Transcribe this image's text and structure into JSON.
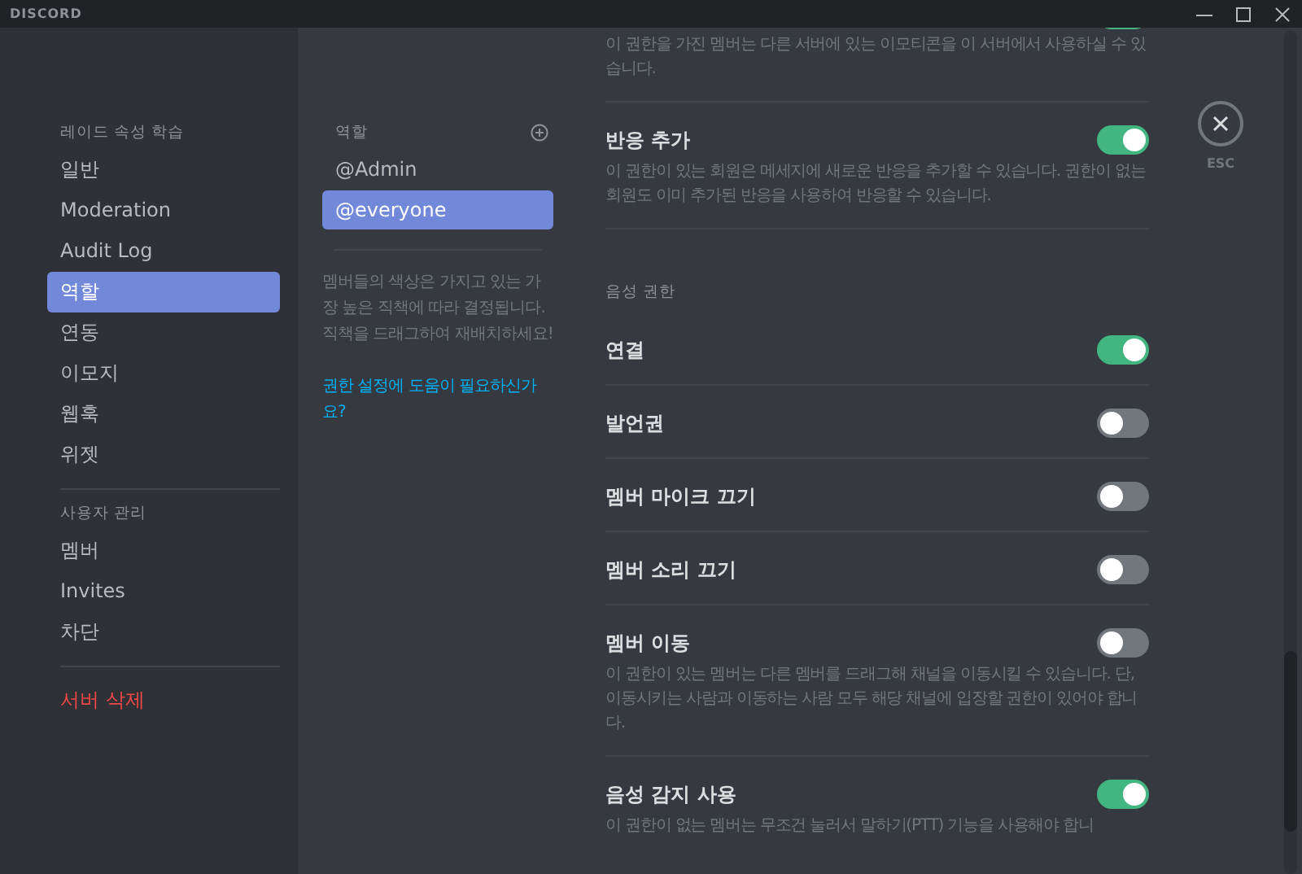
{
  "titlebar": {
    "logo": "DISCORD"
  },
  "sidebar": {
    "sections": [
      {
        "header": "레이드 속성 학습",
        "items": [
          {
            "label": "일반",
            "selected": false
          },
          {
            "label": "Moderation",
            "selected": false
          },
          {
            "label": "Audit Log",
            "selected": false
          },
          {
            "label": "역할",
            "selected": true
          },
          {
            "label": "연동",
            "selected": false
          },
          {
            "label": "이모지",
            "selected": false
          },
          {
            "label": "웹훅",
            "selected": false
          },
          {
            "label": "위젯",
            "selected": false
          }
        ]
      },
      {
        "header": "사용자 관리",
        "items": [
          {
            "label": "멤버",
            "selected": false
          },
          {
            "label": "Invites",
            "selected": false
          },
          {
            "label": "차단",
            "selected": false
          }
        ]
      },
      {
        "items": [
          {
            "label": "서버 삭제",
            "selected": false,
            "kind": "danger"
          }
        ]
      }
    ]
  },
  "roles": {
    "header": "역할",
    "items": [
      {
        "label": "@Admin",
        "selected": false
      },
      {
        "label": "@everyone",
        "selected": true
      }
    ],
    "note": "멤버들의 색상은 가지고 있는 가장 높은 직책에 따라 결정됩니다. 직책을 드래그하여 재배치하세요!",
    "help_link": "권한 설정에 도움이 필요하신가요?"
  },
  "permissions": [
    {
      "kind": "toggle",
      "description": "이 권한을 가진 멤버는 다른 서버에 있는 이모티콘을 이 서버에서 사용하실 수 있습니다.",
      "on": true
    },
    {
      "kind": "toggle",
      "title": "반응 추가",
      "description": "이 권한이 있는 회원은 메세지에 새로운 반응을 추가할 수 있습니다. 권한이 없는 회원도 이미 추가된 반응을 사용하여 반응할 수 있습니다.",
      "on": true
    },
    {
      "kind": "header",
      "title": "음성 권한"
    },
    {
      "kind": "toggle",
      "title": "연결",
      "on": true
    },
    {
      "kind": "toggle",
      "title": "발언권",
      "on": false
    },
    {
      "kind": "toggle",
      "title": "멤버 마이크 끄기",
      "on": false
    },
    {
      "kind": "toggle",
      "title": "멤버 소리 끄기",
      "on": false
    },
    {
      "kind": "toggle",
      "title": "멤버 이동",
      "description": "이 권한이 있는 멤버는 다른 멤버를 드래그해 채널을 이동시킬 수 있습니다. 단, 이동시키는 사람과 이동하는 사람 모두 해당 채널에 입장할 권한이 있어야 합니다.",
      "on": false
    },
    {
      "kind": "toggle",
      "title": "음성 감지 사용",
      "description": "이 권한이 없는 멤버는 무조건 눌러서 말하기(PTT) 기능을 사용해야 합니",
      "on": true
    }
  ],
  "close": {
    "label": "ESC"
  }
}
